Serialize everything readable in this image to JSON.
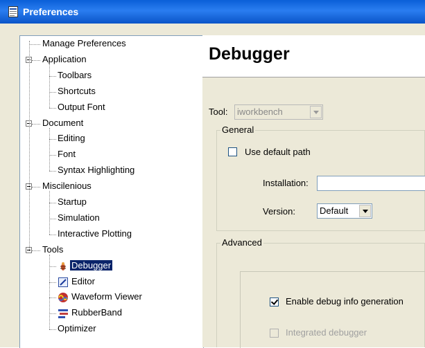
{
  "window": {
    "title": "Preferences"
  },
  "tree": {
    "items": [
      {
        "label": "Manage Preferences",
        "level": 0,
        "expander": false,
        "icon": null
      },
      {
        "label": "Application",
        "level": 0,
        "expander": true,
        "icon": null
      },
      {
        "label": "Toolbars",
        "level": 1,
        "expander": false,
        "icon": null
      },
      {
        "label": "Shortcuts",
        "level": 1,
        "expander": false,
        "icon": null
      },
      {
        "label": "Output Font",
        "level": 1,
        "expander": false,
        "icon": null
      },
      {
        "label": "Document",
        "level": 0,
        "expander": true,
        "icon": null
      },
      {
        "label": "Editing",
        "level": 1,
        "expander": false,
        "icon": null
      },
      {
        "label": "Font",
        "level": 1,
        "expander": false,
        "icon": null
      },
      {
        "label": "Syntax Highlighting",
        "level": 1,
        "expander": false,
        "icon": null
      },
      {
        "label": "Miscilenious",
        "level": 0,
        "expander": true,
        "icon": null
      },
      {
        "label": "Startup",
        "level": 1,
        "expander": false,
        "icon": null
      },
      {
        "label": "Simulation",
        "level": 1,
        "expander": false,
        "icon": null
      },
      {
        "label": "Interactive Plotting",
        "level": 1,
        "expander": false,
        "icon": null
      },
      {
        "label": "Tools",
        "level": 0,
        "expander": true,
        "icon": null
      },
      {
        "label": "Debugger",
        "level": 1,
        "expander": false,
        "icon": "bug-icon",
        "selected": true
      },
      {
        "label": "Editor",
        "level": 1,
        "expander": false,
        "icon": "editor-icon"
      },
      {
        "label": "Waveform Viewer",
        "level": 1,
        "expander": false,
        "icon": "waveform-icon"
      },
      {
        "label": "RubberBand",
        "level": 1,
        "expander": false,
        "icon": "rubberband-icon"
      },
      {
        "label": "Optimizer",
        "level": 1,
        "expander": false,
        "icon": null
      }
    ]
  },
  "panel": {
    "title": "Debugger",
    "tool_label": "Tool:",
    "tool_value": "iworkbench",
    "general": {
      "legend": "General",
      "use_default_path": "Use default path",
      "installation_label": "Installation:",
      "installation_value": "",
      "version_label": "Version:",
      "version_value": "Default"
    },
    "advanced": {
      "legend": "Advanced",
      "enable_debug": "Enable debug info generation",
      "integrated_debugger": "Integrated debugger"
    }
  },
  "colors": {
    "selection": "#0a246a",
    "titlebar": "#0a5fd8",
    "background": "#ece9d8"
  }
}
